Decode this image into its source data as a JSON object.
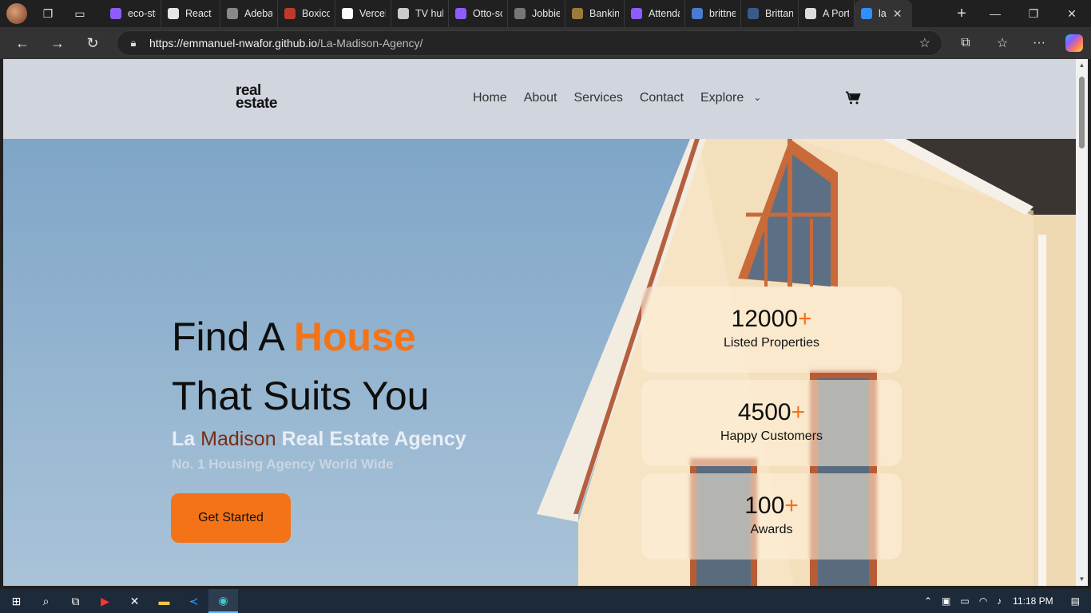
{
  "browser": {
    "tabs": [
      {
        "label": "eco-stu",
        "icon": "vite-icon",
        "color": "#8d5cff"
      },
      {
        "label": "React Ir",
        "icon": "chatgpt-icon",
        "color": "#e6e6e6"
      },
      {
        "label": "Adebay",
        "icon": "bird-icon",
        "color": "#888888"
      },
      {
        "label": "Boxicor",
        "icon": "boxicons-icon",
        "color": "#c0392b"
      },
      {
        "label": "Vercel",
        "icon": "vercel-icon",
        "color": "#ffffff"
      },
      {
        "label": "TV hub",
        "icon": "globe-icon",
        "color": "#cccccc"
      },
      {
        "label": "Otto-sc",
        "icon": "vite-icon",
        "color": "#8d5cff"
      },
      {
        "label": "Jobbie",
        "icon": "page-icon",
        "color": "#777777"
      },
      {
        "label": "Bankinc",
        "icon": "banking-icon",
        "color": "#9a7b3c"
      },
      {
        "label": "Attenda",
        "icon": "vite-icon",
        "color": "#8d5cff"
      },
      {
        "label": "brittney",
        "icon": "search-icon",
        "color": "#4a7bd1"
      },
      {
        "label": "Brittany",
        "icon": "b-icon",
        "color": "#3a5a8a"
      },
      {
        "label": "A Porta",
        "icon": "portal-icon",
        "color": "#dddddd"
      },
      {
        "label": "la",
        "icon": "la-icon",
        "color": "#2f8fff"
      }
    ],
    "url_host": "https://emmanuel-nwafor.github.io",
    "url_path": "/La-Madison-Agency/"
  },
  "site": {
    "logo_line1": "real",
    "logo_line2": "estate",
    "nav": [
      "Home",
      "About",
      "Services",
      "Contact",
      "Explore"
    ]
  },
  "hero": {
    "title_part1": "Find A ",
    "title_accent": "House",
    "title_line2": "That Suits You",
    "subtitle_pre": "La ",
    "subtitle_mid": "Madison",
    "subtitle_post": " Real Estate Agency",
    "tagline": "No. 1 Housing Agency World Wide",
    "cta": "Get Started",
    "accent_color": "#f47317"
  },
  "stats": [
    {
      "value": "12000",
      "plus": "+",
      "label": "Listed Properties"
    },
    {
      "value": "4500",
      "plus": "+",
      "label": "Happy Customers"
    },
    {
      "value": "100",
      "plus": "+",
      "label": "Awards"
    }
  ],
  "taskbar": {
    "time": "11:18 PM"
  }
}
